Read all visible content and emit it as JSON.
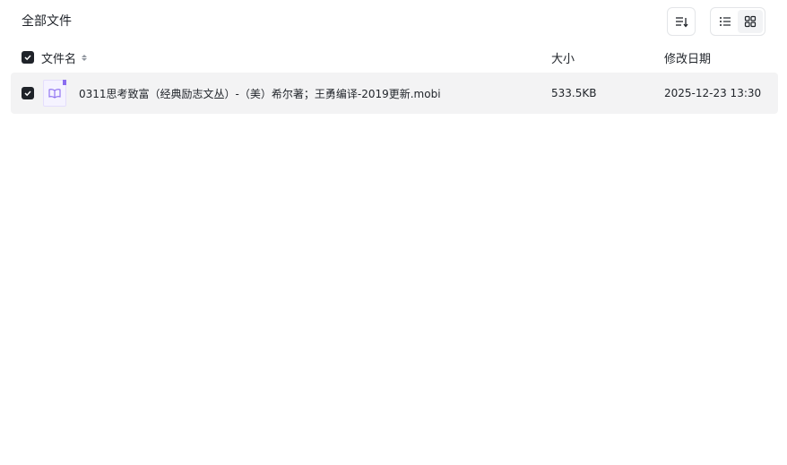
{
  "breadcrumb": {
    "title": "全部文件"
  },
  "toolbar": {
    "sort_icon": "sort-lines-icon",
    "list_view_icon": "list-view-icon",
    "grid_view_icon": "grid-view-icon"
  },
  "table": {
    "columns": {
      "name": "文件名",
      "size": "大小",
      "modified": "修改日期"
    },
    "rows": [
      {
        "name": "0311思考致富（经典励志文丛）-（美）希尔著；王勇编译-2019更新.mobi",
        "size": "533.5KB",
        "modified": "2025-12-23 13:30",
        "icon": "book-icon",
        "checked": true
      }
    ]
  },
  "colors": {
    "text": "#1f2329",
    "row_highlight": "#f3f3f4",
    "book_accent": "#8a6cf0"
  }
}
